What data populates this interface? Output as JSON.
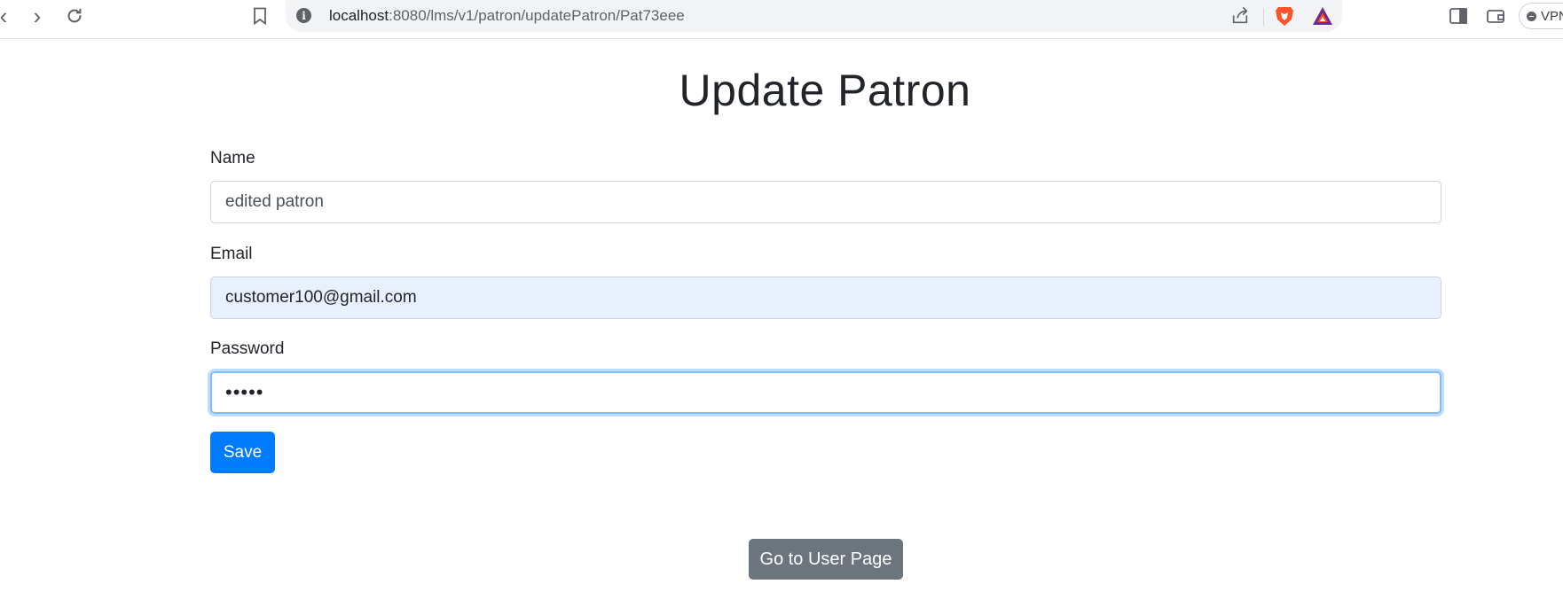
{
  "browser": {
    "url_host": "localhost",
    "url_rest": ":8080/lms/v1/patron/updatePatron/Pat73eee",
    "vpn_label": "VPN",
    "icons": {
      "back": "chevron-left-icon",
      "forward": "chevron-right-icon",
      "reload": "reload-icon",
      "bookmark": "bookmark-icon",
      "site_info": "info-icon",
      "share": "share-icon",
      "brave": "brave-shield-icon",
      "rewards": "bat-triangle-icon",
      "sidebar": "sidebar-icon",
      "wallet": "wallet-icon"
    },
    "colors": {
      "brave": "#fb542b",
      "bat_outer": "#662d91",
      "bat_inner": "#ff4724"
    }
  },
  "page": {
    "title": "Update Patron"
  },
  "form": {
    "name_label": "Name",
    "name_value": "edited patron",
    "email_label": "Email",
    "email_value": "customer100@gmail.com",
    "password_label": "Password",
    "password_value": "•••••",
    "save_label": "Save"
  },
  "footer": {
    "user_page_label": "Go to User Page"
  },
  "colors": {
    "primary": "#007bff",
    "secondary": "#6c757d",
    "autofill": "#e8f0fe",
    "focus": "#80bdff"
  }
}
